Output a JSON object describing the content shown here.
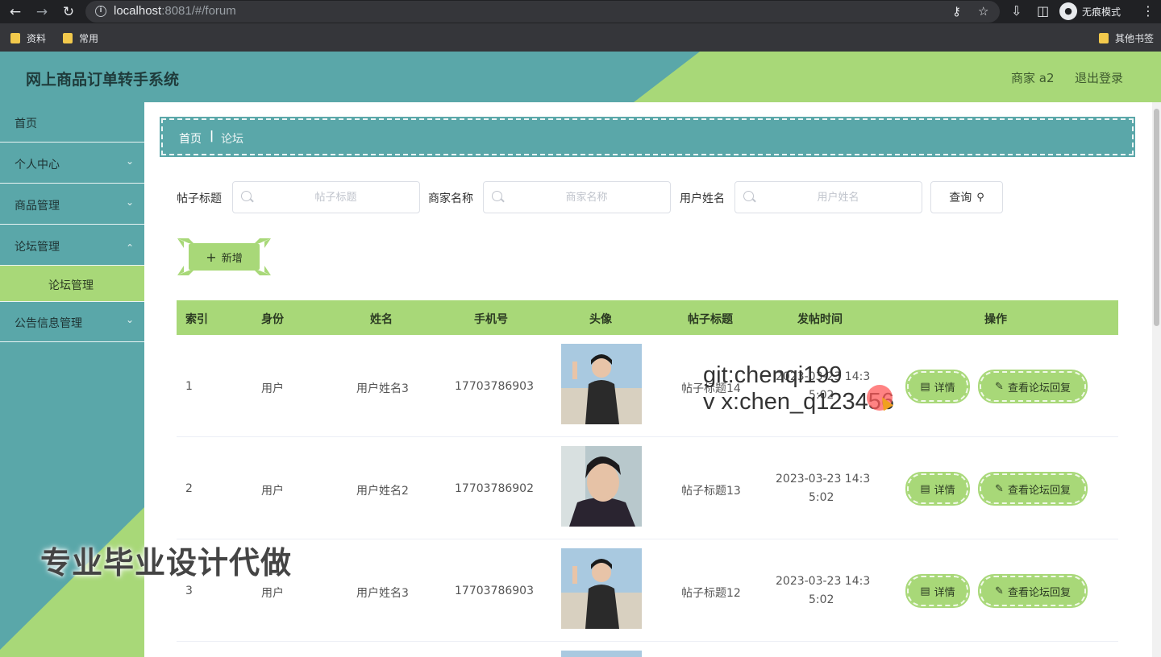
{
  "browser": {
    "url_host": "localhost",
    "url_rest": ":8081/#/forum",
    "incognito_label": "无痕模式",
    "bookmarks": [
      "资料",
      "常用"
    ],
    "other_bookmarks": "其他书签"
  },
  "header": {
    "title": "网上商品订单转手系统",
    "user": "商家 a2",
    "logout": "退出登录"
  },
  "sidebar": {
    "items": [
      {
        "label": "首页"
      },
      {
        "label": "个人中心"
      },
      {
        "label": "商品管理"
      },
      {
        "label": "论坛管理"
      },
      {
        "label": "论坛管理"
      },
      {
        "label": "公告信息管理"
      }
    ]
  },
  "breadcrumb": {
    "home": "首页",
    "separator": "|",
    "current": "论坛"
  },
  "search": {
    "fields": [
      {
        "label": "帖子标题",
        "placeholder": "帖子标题",
        "value": ""
      },
      {
        "label": "商家名称",
        "placeholder": "商家名称",
        "value": ""
      },
      {
        "label": "用户姓名",
        "placeholder": "用户姓名",
        "value": ""
      }
    ],
    "query_label": "查询"
  },
  "actions": {
    "add_label": "新增"
  },
  "table": {
    "headers": [
      "索引",
      "身份",
      "姓名",
      "手机号",
      "头像",
      "帖子标题",
      "发帖时间",
      "操作"
    ],
    "rows": [
      {
        "index": "1",
        "role": "用户",
        "name": "用户姓名3",
        "phone": "17703786903",
        "title": "帖子标题14",
        "time_line1": "2023-03-23 14:3",
        "time_line2": "5:02"
      },
      {
        "index": "2",
        "role": "用户",
        "name": "用户姓名2",
        "phone": "17703786902",
        "title": "帖子标题13",
        "time_line1": "2023-03-23 14:3",
        "time_line2": "5:02"
      },
      {
        "index": "3",
        "role": "用户",
        "name": "用户姓名3",
        "phone": "17703786903",
        "title": "帖子标题12",
        "time_line1": "2023-03-23 14:3",
        "time_line2": "5:02"
      }
    ],
    "detail_label": "详情",
    "reply_label": "查看论坛回复"
  },
  "overlay": {
    "git_line": "git:chenqi199",
    "vx_line": "v x:chen_q123456",
    "banner": "专业毕业设计代做"
  },
  "colors": {
    "teal": "#5aa7a9",
    "green": "#a8d878",
    "browser_dark": "#202124"
  }
}
